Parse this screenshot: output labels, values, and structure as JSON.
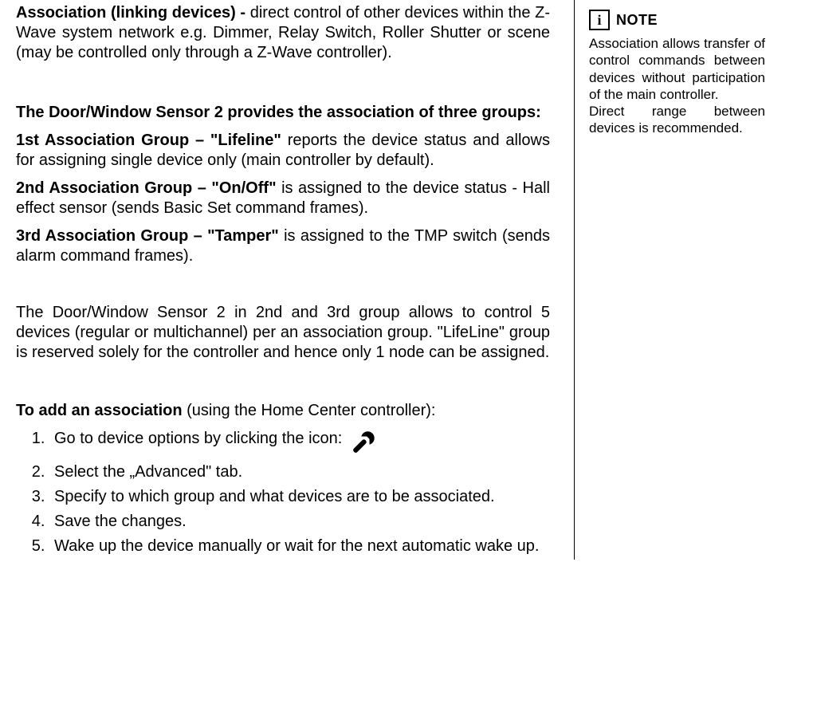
{
  "intro": {
    "lead": "Association (linking devices) - ",
    "rest": "direct control of other devices within the Z-Wave system network e.g. Dimmer, Relay Switch, Roller Shutter or scene (may be controlled only through a Z-Wave controller)."
  },
  "groups_heading": "The Door/Window Sensor 2 provides the association of three groups:",
  "g1": {
    "lead": "1st Association Group – \"Lifeline\"",
    "rest": " reports the device status and allows for assigning single device only (main controller by default)."
  },
  "g2": {
    "lead": "2nd Association Group –  \"On/Off\"",
    "rest": " is assigned to the device status - Hall effect sensor (sends Basic Set command frames)."
  },
  "g3": {
    "lead": "3rd Association Group – \"Tamper\"",
    "rest": " is assigned to the TMP switch (sends alarm command frames)."
  },
  "limits": "The Door/Window Sensor 2 in 2nd and 3rd group allows to control 5 devices (regular or multichannel) per an association group. \"LifeLine\" group is reserved solely for the controller and hence only 1 node can  be assigned.",
  "add_assoc": {
    "lead": "To add an association",
    "rest": " (using the Home Center controller):"
  },
  "steps": {
    "s1": "Go to device options by clicking the icon:",
    "s2": "Select the „Advanced\" tab.",
    "s3": "Specify to which group and what devices are to be associated.",
    "s4": "Save the changes.",
    "s5": "Wake up the device manually or wait for the next automatic wake up."
  },
  "note": {
    "icon_letter": "i",
    "title": "NOTE",
    "body1": "Association allows transfer of control commands between devices without participation of the main controller.",
    "body2": "Direct range between devices is recommended."
  }
}
